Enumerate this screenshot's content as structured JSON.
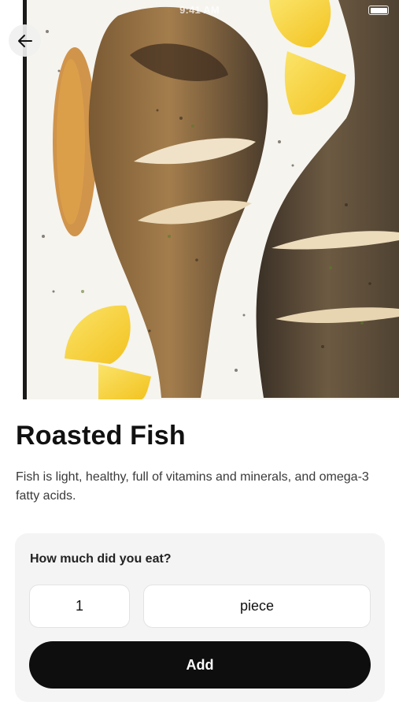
{
  "status_bar": {
    "time": "9:41 AM"
  },
  "nav": {
    "back_icon": "arrow-left-icon"
  },
  "food": {
    "title": "Roasted Fish",
    "description": "Fish is light, healthy, full of vitamins and minerals, and omega-3 fatty acids."
  },
  "portion": {
    "label": "How much did you eat?",
    "quantity": "1",
    "unit": "piece",
    "add_label": "Add"
  },
  "colors": {
    "button": "#0e0e0e",
    "card": "#f4f4f4",
    "lemon": "#f8d33a"
  }
}
